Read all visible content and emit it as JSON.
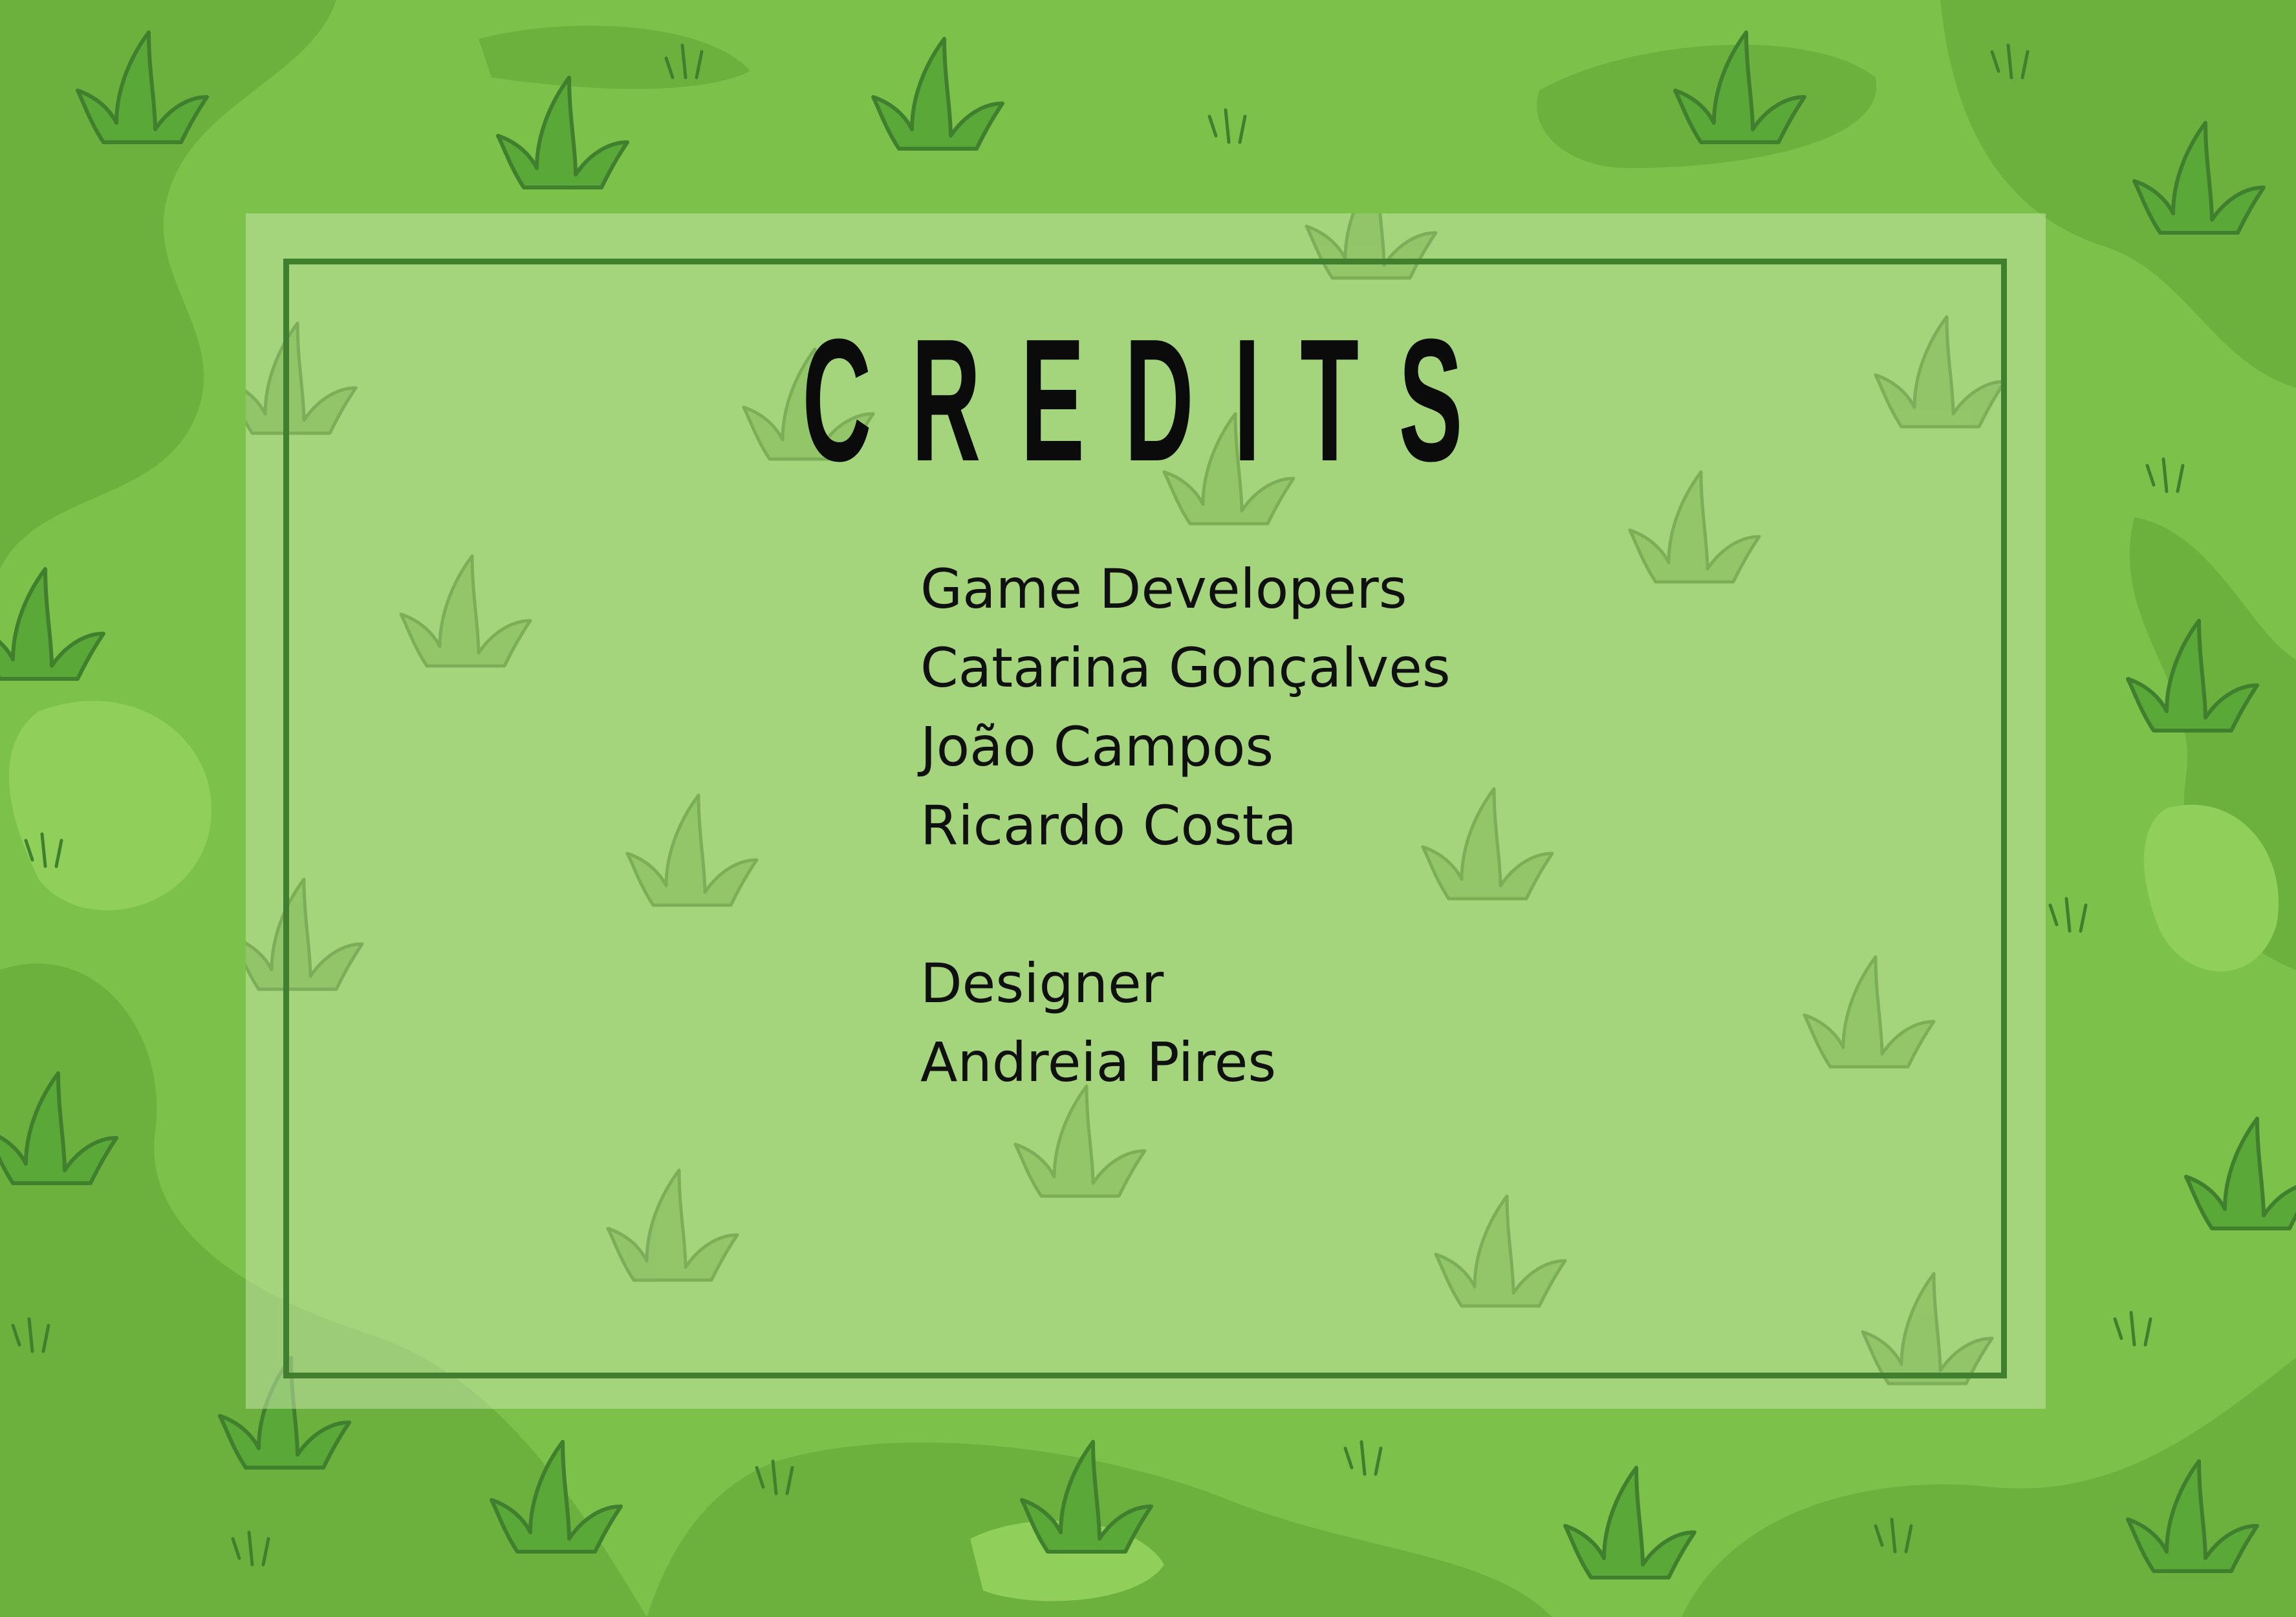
{
  "screen": {
    "title": "CREDITS",
    "colors": {
      "grass_base": "#7cc24a",
      "grass_dark": "#6cb03e",
      "grass_light": "#8fcf5a",
      "tuft": "#5aa838",
      "tuft_outline": "#3f7f2e",
      "panel_overlay": "#c4e4a6",
      "frame_border": "#3f7f2e",
      "text": "#101010"
    },
    "sections": [
      {
        "heading": "Game Developers",
        "names": [
          "Catarina Gonçalves",
          "João Campos",
          "Ricardo Costa"
        ]
      },
      {
        "heading": "Designer",
        "names": [
          "Andreia Pires"
        ]
      }
    ]
  }
}
